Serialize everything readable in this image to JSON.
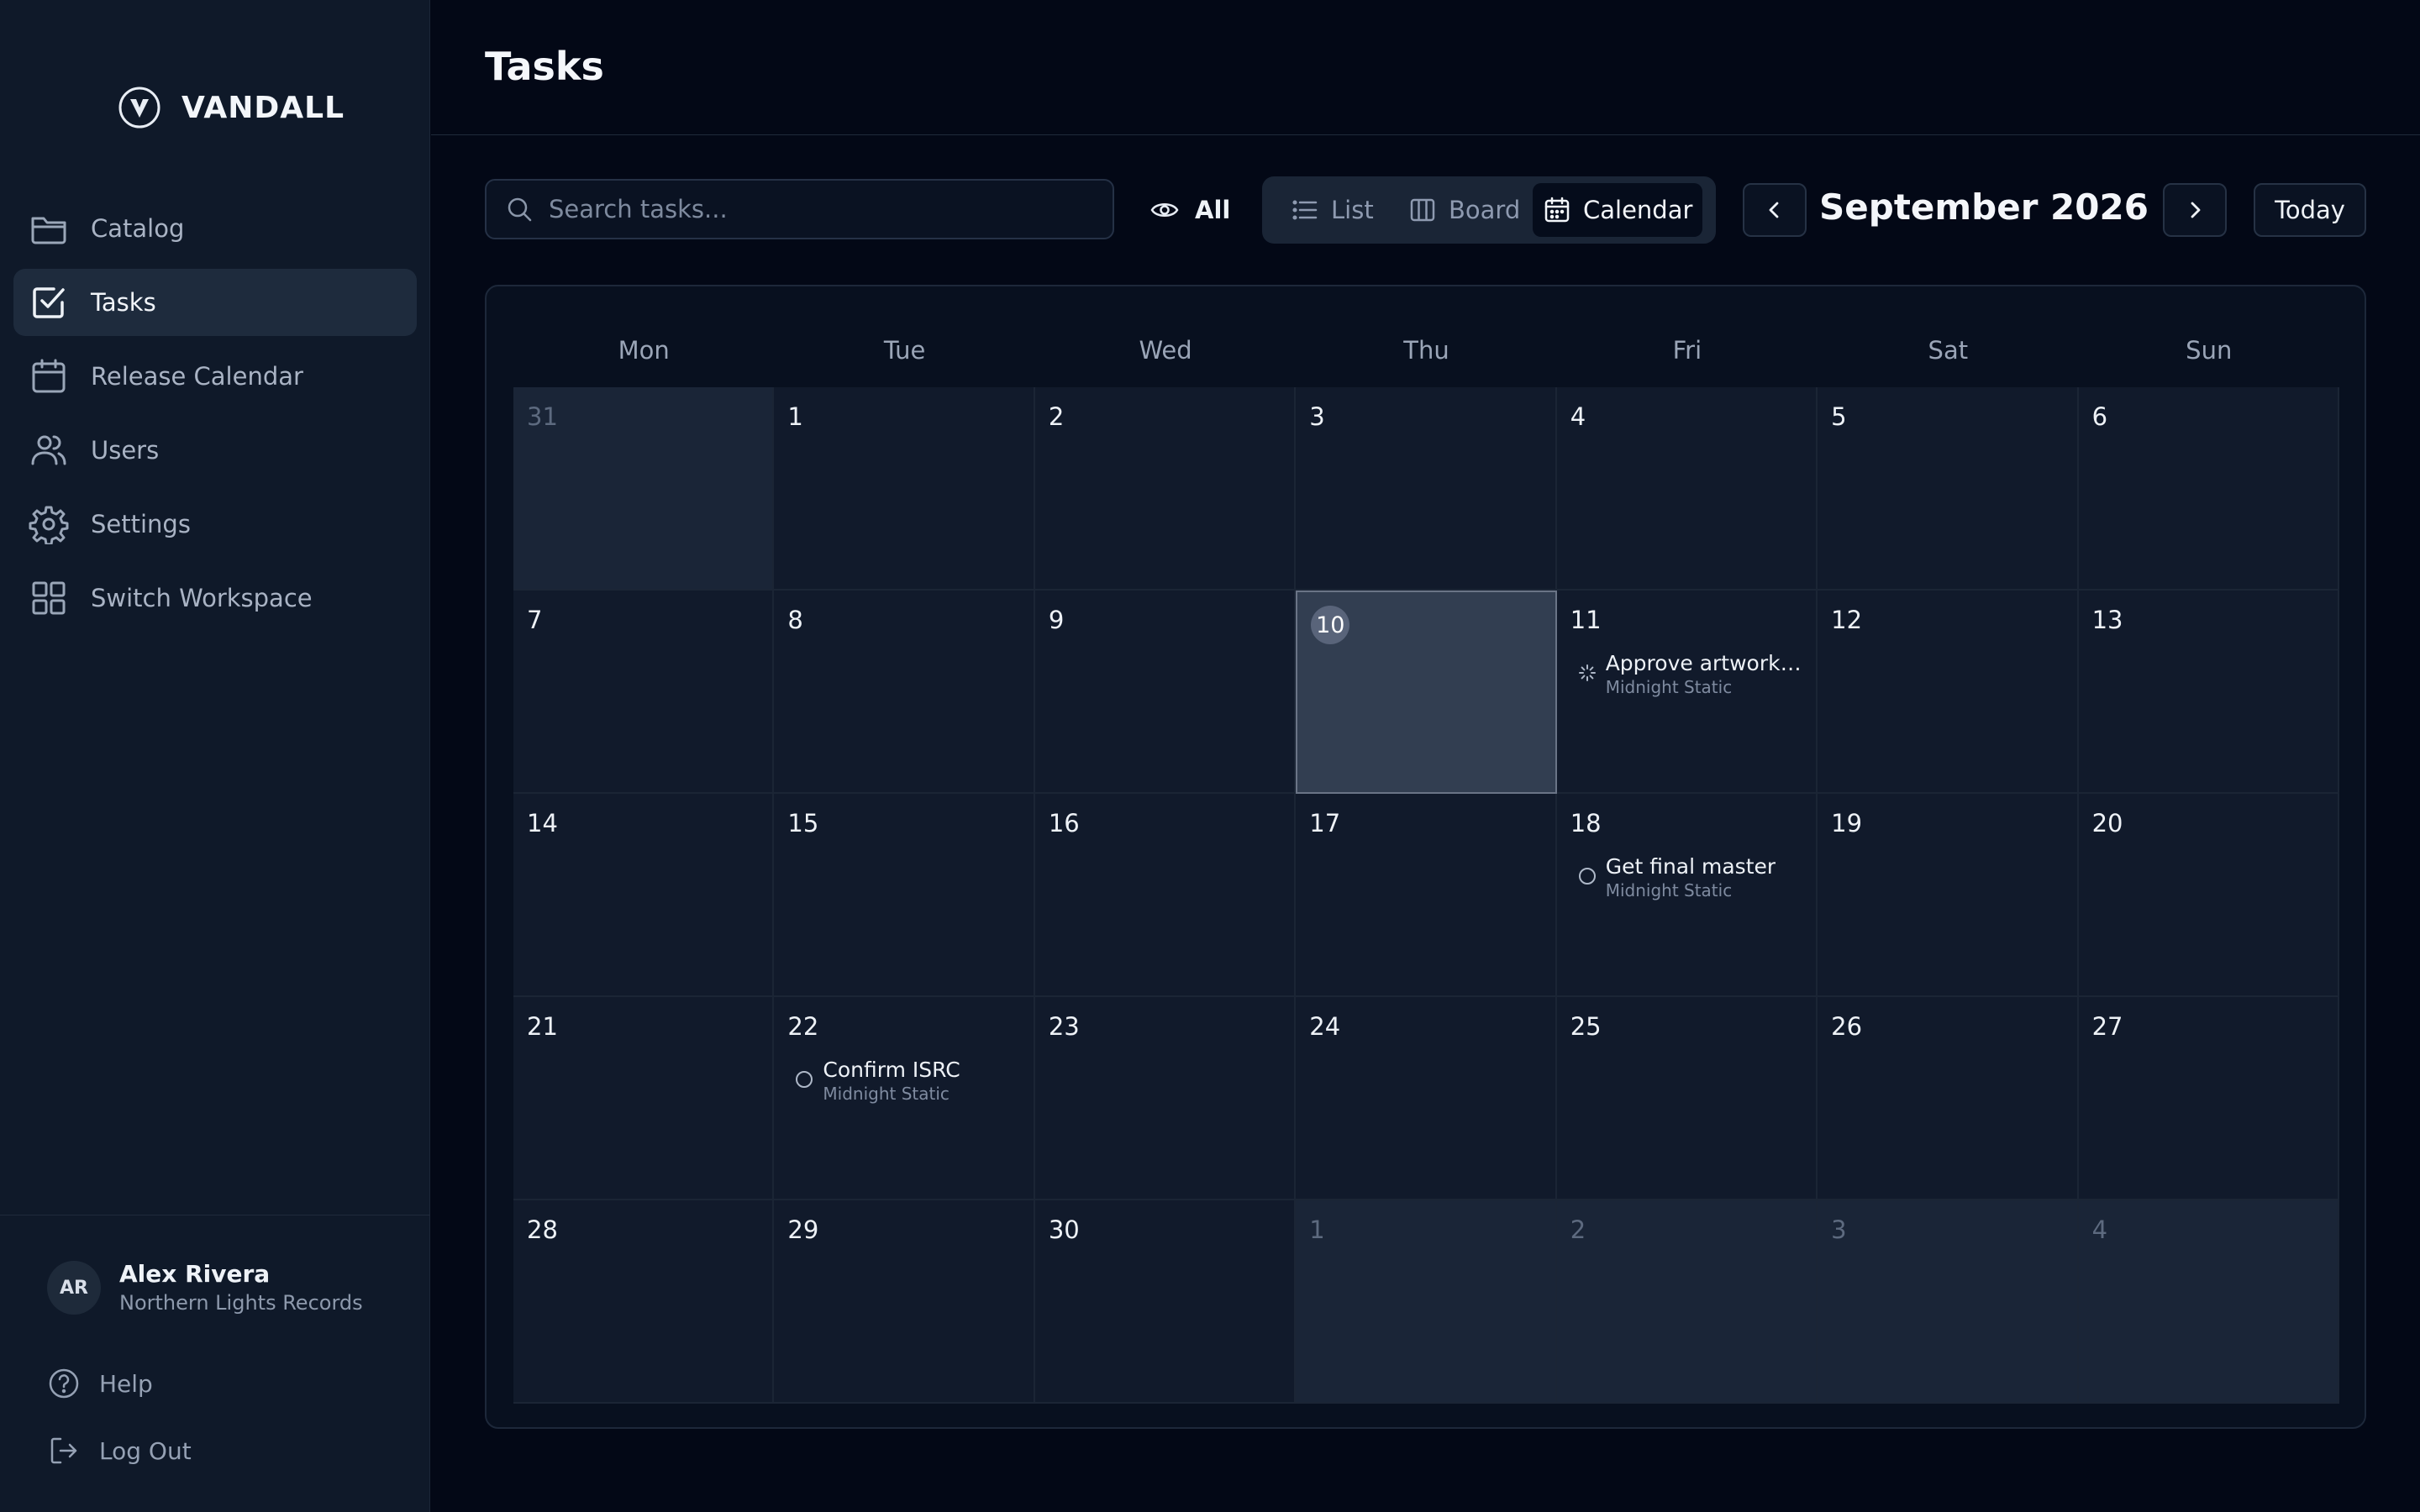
{
  "brand": {
    "name": "VANDALL"
  },
  "sidebar": {
    "items": [
      {
        "label": "Catalog",
        "icon": "folder-icon",
        "active": false
      },
      {
        "label": "Tasks",
        "icon": "checkbox-icon",
        "active": true
      },
      {
        "label": "Release Calendar",
        "icon": "calendar-icon",
        "active": false
      },
      {
        "label": "Users",
        "icon": "users-icon",
        "active": false
      },
      {
        "label": "Settings",
        "icon": "gear-icon",
        "active": false
      },
      {
        "label": "Switch Workspace",
        "icon": "grid-icon",
        "active": false
      }
    ],
    "user": {
      "initials": "AR",
      "name": "Alex Rivera",
      "org": "Northern Lights Records"
    },
    "help_label": "Help",
    "logout_label": "Log Out"
  },
  "header": {
    "title": "Tasks"
  },
  "toolbar": {
    "search_placeholder": "Search tasks...",
    "filter_label": "All",
    "views": [
      {
        "label": "List",
        "icon": "list-icon",
        "active": false
      },
      {
        "label": "Board",
        "icon": "columns-icon",
        "active": false
      },
      {
        "label": "Calendar",
        "icon": "calendar-icon",
        "active": true
      }
    ],
    "month_label": "September 2026",
    "today_label": "Today"
  },
  "calendar": {
    "weekdays": [
      "Mon",
      "Tue",
      "Wed",
      "Thu",
      "Fri",
      "Sat",
      "Sun"
    ],
    "weeks": [
      [
        {
          "day": "31",
          "out": true
        },
        {
          "day": "1"
        },
        {
          "day": "2"
        },
        {
          "day": "3"
        },
        {
          "day": "4"
        },
        {
          "day": "5"
        },
        {
          "day": "6"
        }
      ],
      [
        {
          "day": "7"
        },
        {
          "day": "8"
        },
        {
          "day": "9"
        },
        {
          "day": "10",
          "today": true
        },
        {
          "day": "11",
          "task": {
            "title": "Approve artwork c...",
            "sub": "Midnight Static",
            "status": "in-progress"
          }
        },
        {
          "day": "12"
        },
        {
          "day": "13"
        }
      ],
      [
        {
          "day": "14"
        },
        {
          "day": "15"
        },
        {
          "day": "16"
        },
        {
          "day": "17"
        },
        {
          "day": "18",
          "task": {
            "title": "Get final master",
            "sub": "Midnight Static",
            "status": "todo"
          }
        },
        {
          "day": "19"
        },
        {
          "day": "20"
        }
      ],
      [
        {
          "day": "21"
        },
        {
          "day": "22",
          "task": {
            "title": "Confirm ISRC",
            "sub": "Midnight Static",
            "status": "todo"
          }
        },
        {
          "day": "23"
        },
        {
          "day": "24"
        },
        {
          "day": "25"
        },
        {
          "day": "26"
        },
        {
          "day": "27"
        }
      ],
      [
        {
          "day": "28"
        },
        {
          "day": "29"
        },
        {
          "day": "30"
        },
        {
          "day": "1",
          "out": true
        },
        {
          "day": "2",
          "out": true
        },
        {
          "day": "3",
          "out": true
        },
        {
          "day": "4",
          "out": true
        }
      ]
    ]
  }
}
